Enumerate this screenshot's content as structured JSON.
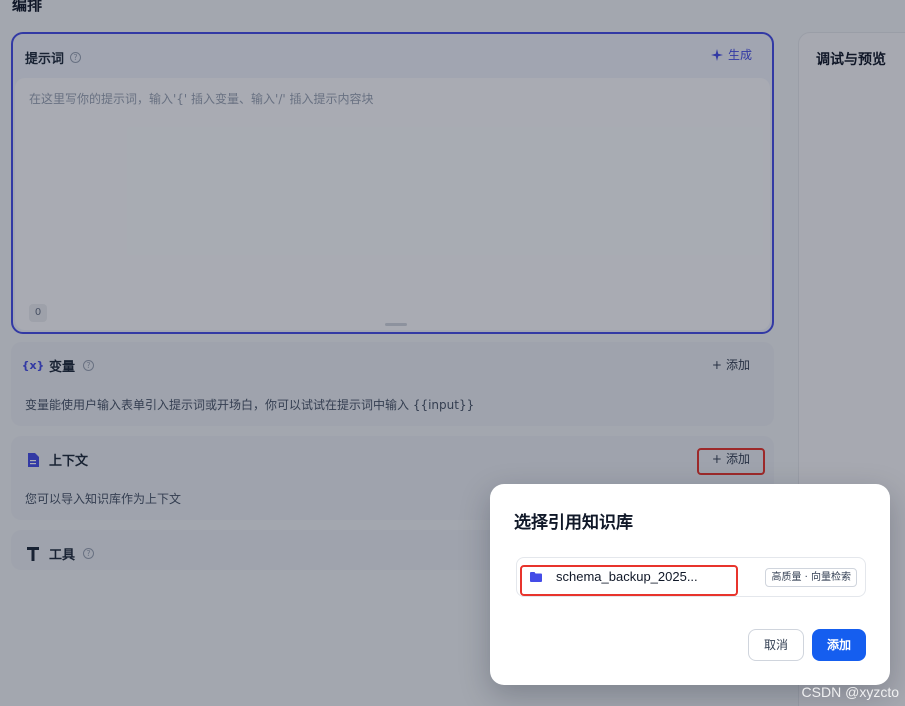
{
  "section": {
    "title": "编排"
  },
  "prompt": {
    "label": "提示词",
    "help": "?",
    "generate_label": "生成",
    "placeholder": "在这里写你的提示词，输入'{' 插入变量、输入'/' 插入提示内容块",
    "char_count": "0"
  },
  "variables": {
    "icon_text": "{x}",
    "label": "变量",
    "help": "?",
    "add_label": "添加",
    "description": "变量能使用户输入表单引入提示词或开场白，你可以试试在提示词中输入 {{input}}"
  },
  "context": {
    "label": "上下文",
    "add_label": "添加",
    "description": "您可以导入知识库作为上下文"
  },
  "tools": {
    "label": "工具",
    "help": "?"
  },
  "right_panel": {
    "title": "调试与预览"
  },
  "modal": {
    "title": "选择引用知识库",
    "kb_name": "schema_backup_2025...",
    "kb_badge": "高质量 · 向量检索",
    "cancel_label": "取消",
    "add_label": "添加"
  },
  "watermark": "CSDN @xyzcto",
  "colors": {
    "accent": "#444ce7",
    "primary_button": "#155eef",
    "highlight": "#e8342c"
  }
}
